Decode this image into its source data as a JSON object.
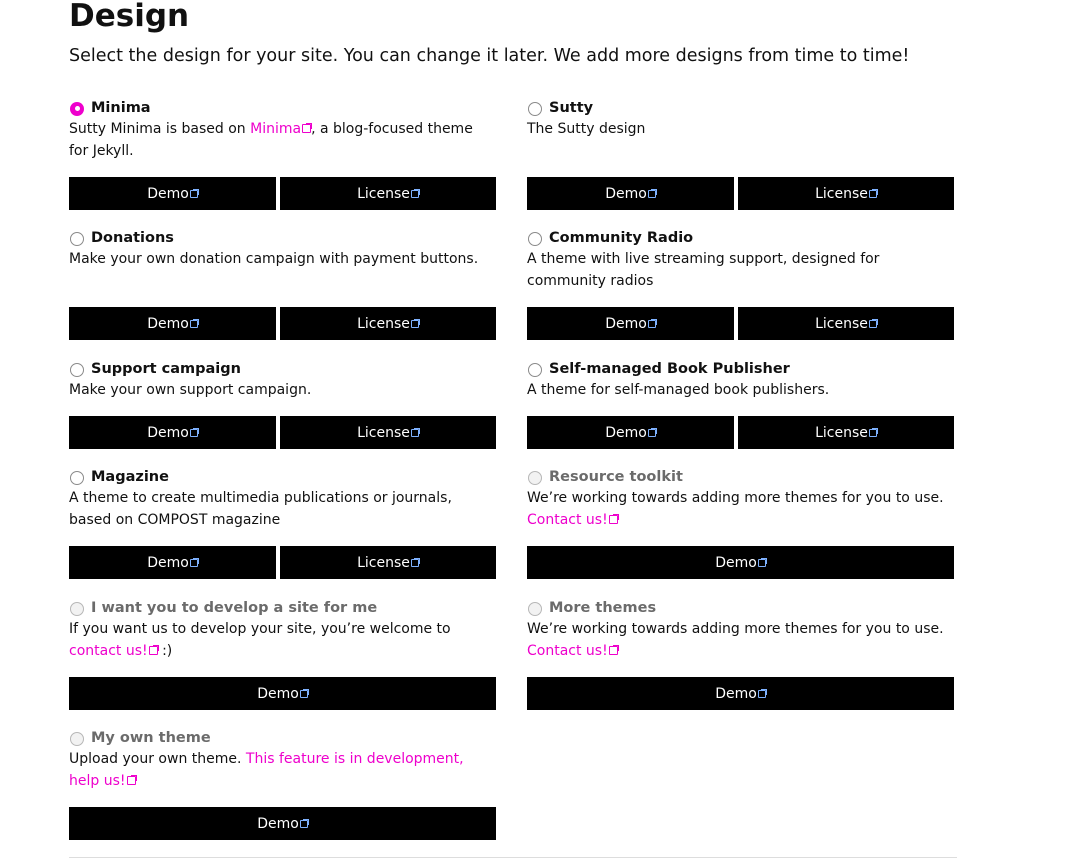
{
  "page": {
    "title": "Design",
    "subtitle": "Select the design for your site. You can change it later. We add more designs from time to time!"
  },
  "colors": {
    "accent": "#ee00cc",
    "button_bg": "#000000",
    "button_text": "#ffffff"
  },
  "buttons": {
    "demo": "Demo",
    "license": "License"
  },
  "options": {
    "minima": {
      "title": "Minima",
      "selected": true,
      "desc_before": "Sutty Minima is based on ",
      "desc_link": "Minima",
      "desc_after": ", a blog-focused theme for Jekyll."
    },
    "sutty": {
      "title": "Sutty",
      "desc": "The Sutty design"
    },
    "donations": {
      "title": "Donations",
      "desc": "Make your own donation campaign with payment buttons."
    },
    "community_radio": {
      "title": "Community Radio",
      "desc": "A theme with live streaming support, designed for community radios"
    },
    "support_campaign": {
      "title": "Support campaign",
      "desc": "Make your own support campaign."
    },
    "book_publisher": {
      "title": "Self-managed Book Publisher",
      "desc": "A theme for self-managed book publishers."
    },
    "magazine": {
      "title": "Magazine",
      "desc": "A theme to create multimedia publications or journals, based on COMPOST magazine"
    },
    "resource_toolkit": {
      "title": "Resource toolkit",
      "desc": "We’re working towards adding more themes for you to use.",
      "link": "Contact us!"
    },
    "develop_site": {
      "title": "I want you to develop a site for me",
      "desc_before": "If you want us to develop your site, you’re welcome to ",
      "desc_link": "contact us!",
      "desc_after": " :)"
    },
    "more_themes": {
      "title": "More themes",
      "desc": "We’re working towards adding more themes for you to use.",
      "link": "Contact us!"
    },
    "own_theme": {
      "title": "My own theme",
      "desc_before": "Upload your own theme. ",
      "desc_link": "This feature is in development, help us!"
    }
  }
}
